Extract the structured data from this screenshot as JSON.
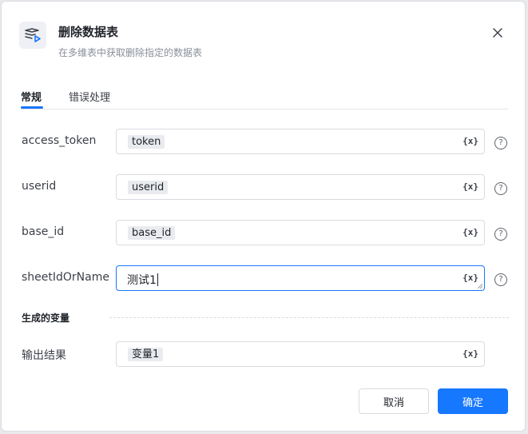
{
  "dialog": {
    "title": "删除数据表",
    "subtitle": "在多维表中获取删除指定的数据表",
    "icon": "table-delete-icon"
  },
  "tabs": [
    {
      "label": "常规",
      "active": true
    },
    {
      "label": "错误处理",
      "active": false
    }
  ],
  "fields": [
    {
      "label": "access_token",
      "value": "token",
      "value_type": "variable-tag"
    },
    {
      "label": "userid",
      "value": "userid",
      "value_type": "variable-tag"
    },
    {
      "label": "base_id",
      "value": "base_id",
      "value_type": "variable-tag"
    },
    {
      "label": "sheetIdOrName",
      "value": "测试1",
      "value_type": "text",
      "focused": true
    }
  ],
  "variable_button": "{x}",
  "help_glyph": "?",
  "output_section": {
    "title": "生成的变量",
    "label": "输出结果",
    "value": "变量1"
  },
  "footer": {
    "cancel_label": "取消",
    "ok_label": "确定"
  },
  "colors": {
    "accent": "#1677ff",
    "tag_bg": "#e9ebef",
    "border": "#d9dbe0"
  }
}
